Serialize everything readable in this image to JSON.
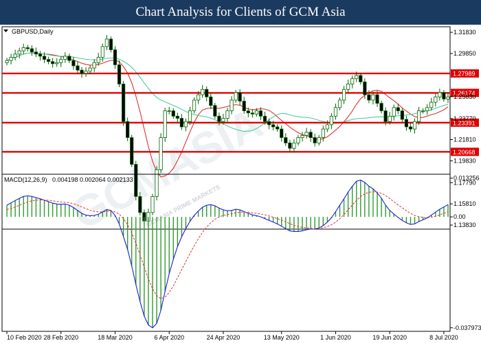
{
  "banner": {
    "title": "Chart Analysis for Clients of GCM Asia"
  },
  "watermark": {
    "brand": "GCMASIA",
    "tagline": "GCMASIA PRIME MARKETS"
  },
  "colors": {
    "banner_bg": "#1b3a5f",
    "level_line": "#e00000",
    "level_label_bg": "#e00000",
    "ma_fast": "#e03030",
    "ma_slow": "#45d0a0",
    "macd_line": "#1a1adb",
    "signal_line": "#e03030",
    "histogram": "#2e9a2e",
    "candle": "#006400"
  },
  "chart_data": [
    {
      "type": "candlestick",
      "title": "GBPUSD,Daily",
      "ylim": [
        1.1345,
        1.3235
      ],
      "price_ticks": [
        "1.31830",
        "1.29850",
        "1.25830",
        "1.23770",
        "1.21810",
        "1.19830",
        "1.17790",
        "1.15810",
        "1.13830"
      ],
      "levels": [
        {
          "label": "1.27989",
          "value": 1.27989
        },
        {
          "label": "1.26174",
          "value": 1.26174
        },
        {
          "label": "1.23391",
          "value": 1.23391
        },
        {
          "label": "1.20668",
          "value": 1.20668
        }
      ],
      "x_labels": [
        "10 Feb 2020",
        "28 Feb 2020",
        "18 Mar 2020",
        "6 Apr 2020",
        "24 Apr 2020",
        "13 May 2020",
        "1 Jun 2020",
        "19 Jun 2020",
        "8 Jul 2020"
      ],
      "closes": [
        1.292,
        1.295,
        1.298,
        1.301,
        1.304,
        1.303,
        1.3,
        1.298,
        1.296,
        1.293,
        1.291,
        1.289,
        1.29,
        1.293,
        1.296,
        1.292,
        1.287,
        1.283,
        1.28,
        1.282,
        1.285,
        1.29,
        1.295,
        1.305,
        1.312,
        1.302,
        1.288,
        1.27,
        1.235,
        1.22,
        1.195,
        1.165,
        1.15,
        1.142,
        1.15,
        1.165,
        1.19,
        1.22,
        1.245,
        1.245,
        1.24,
        1.238,
        1.23,
        1.235,
        1.245,
        1.255,
        1.26,
        1.265,
        1.258,
        1.25,
        1.24,
        1.235,
        1.238,
        1.245,
        1.255,
        1.262,
        1.254,
        1.245,
        1.243,
        1.242,
        1.245,
        1.24,
        1.235,
        1.232,
        1.23,
        1.228,
        1.22,
        1.215,
        1.21,
        1.215,
        1.22,
        1.222,
        1.225,
        1.22,
        1.215,
        1.22,
        1.228,
        1.232,
        1.24,
        1.248,
        1.255,
        1.265,
        1.27,
        1.275,
        1.278,
        1.272,
        1.26,
        1.255,
        1.26,
        1.252,
        1.245,
        1.235,
        1.24,
        1.248,
        1.245,
        1.237,
        1.23,
        1.228,
        1.235,
        1.245,
        1.245,
        1.248,
        1.253,
        1.258,
        1.262,
        1.256,
        1.258
      ]
    },
    {
      "type": "histogram",
      "title": "MACD(12,26,9)",
      "values_text": "0.004198 0.002064 0.002133",
      "ylim": [
        -0.0392,
        0.0146
      ],
      "y_ticks": [
        "0.013256",
        "0.00",
        "-0.037973"
      ],
      "macd": [
        0.004,
        0.0048,
        0.0056,
        0.0063,
        0.007,
        0.0072,
        0.007,
        0.0066,
        0.0062,
        0.0057,
        0.0052,
        0.0047,
        0.0044,
        0.0043,
        0.0044,
        0.004,
        0.0032,
        0.0022,
        0.0012,
        0.0006,
        0.0004,
        0.0005,
        0.0009,
        0.0017,
        0.0025,
        0.0022,
        0.0005,
        -0.0024,
        -0.0067,
        -0.0112,
        -0.0168,
        -0.0232,
        -0.029,
        -0.034,
        -0.037,
        -0.038,
        -0.0365,
        -0.032,
        -0.0255,
        -0.0195,
        -0.0145,
        -0.0102,
        -0.0068,
        -0.004,
        -0.0015,
        0.0005,
        0.002,
        0.0033,
        0.004,
        0.0042,
        0.0038,
        0.003,
        0.0024,
        0.0021,
        0.0022,
        0.0026,
        0.0024,
        0.0018,
        0.0012,
        0.0007,
        0.0004,
        0.0,
        -0.0006,
        -0.0012,
        -0.0018,
        -0.0024,
        -0.0032,
        -0.004,
        -0.0048,
        -0.005,
        -0.005,
        -0.0048,
        -0.0044,
        -0.0042,
        -0.0042,
        -0.0038,
        -0.003,
        -0.0018,
        -0.0003,
        0.0018,
        0.004,
        0.0062,
        0.0085,
        0.0105,
        0.0122,
        0.0126,
        0.0118,
        0.0105,
        0.0096,
        0.0082,
        0.0064,
        0.004,
        0.0022,
        0.001,
        -0.0002,
        -0.0012,
        -0.002,
        -0.0026,
        -0.0024,
        -0.0016,
        -0.001,
        -0.0004,
        0.0006,
        0.0016,
        0.0026,
        0.0034,
        0.0042
      ],
      "signal": [
        0.0025,
        0.0029,
        0.0034,
        0.004,
        0.0046,
        0.0051,
        0.0055,
        0.0057,
        0.0058,
        0.0058,
        0.0057,
        0.0055,
        0.0053,
        0.0051,
        0.005,
        0.0048,
        0.0045,
        0.004,
        0.0034,
        0.0028,
        0.0023,
        0.0019,
        0.0017,
        0.0017,
        0.0019,
        0.002,
        0.0017,
        0.0009,
        -0.0006,
        -0.0027,
        -0.0055,
        -0.009,
        -0.013,
        -0.0172,
        -0.0212,
        -0.0246,
        -0.027,
        -0.028,
        -0.0275,
        -0.0259,
        -0.0236,
        -0.0209,
        -0.0181,
        -0.0153,
        -0.0125,
        -0.0099,
        -0.0075,
        -0.0053,
        -0.0035,
        -0.002,
        -0.0008,
        0.0,
        0.0005,
        0.0008,
        0.0011,
        0.0014,
        0.0016,
        0.0016,
        0.0016,
        0.0014,
        0.0012,
        0.001,
        0.0007,
        0.0003,
        -0.0001,
        -0.0006,
        -0.0011,
        -0.0017,
        -0.0023,
        -0.0029,
        -0.0033,
        -0.0036,
        -0.0038,
        -0.0039,
        -0.004,
        -0.0039,
        -0.0037,
        -0.0033,
        -0.0027,
        -0.0018,
        -0.0006,
        0.0008,
        0.0024,
        0.004,
        0.0056,
        0.007,
        0.0079,
        0.0084,
        0.0086,
        0.0085,
        0.0081,
        0.0073,
        0.0063,
        0.0052,
        0.0041,
        0.0031,
        0.0021,
        0.0012,
        0.0005,
        0.0001,
        -0.0002,
        -0.0003,
        -0.0001,
        0.0002,
        0.0007,
        0.0012,
        0.0018
      ]
    }
  ]
}
